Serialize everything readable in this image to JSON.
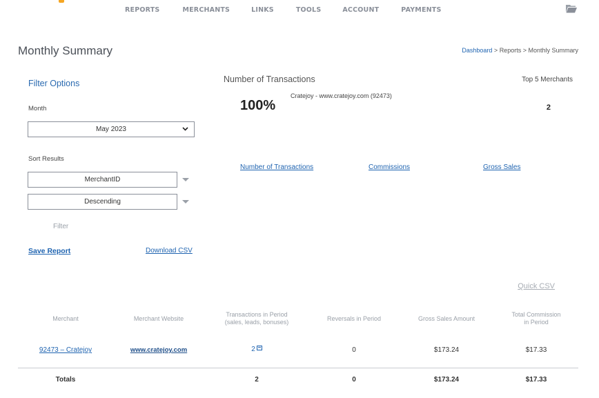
{
  "nav": {
    "items": [
      "REPORTS",
      "MERCHANTS",
      "LINKS",
      "TOOLS",
      "ACCOUNT",
      "PAYMENTS"
    ]
  },
  "icons": {
    "folder": "folder-open-icon",
    "logo": "logo-mark",
    "external": "external-link-icon",
    "dropdown": "chevron-down-icon"
  },
  "colors": {
    "link": "#1e63b0",
    "accent": "#f5a623",
    "muted": "#9aa0a8"
  },
  "page": {
    "title": "Monthly Summary"
  },
  "breadcrumb": {
    "dashboard": "Dashboard",
    "sep1": " > ",
    "reports": "Reports",
    "sep2": " > ",
    "current": "Monthly Summary"
  },
  "filter": {
    "title": "Filter Options",
    "month_label": "Month",
    "month_value": "May 2023",
    "sort_label": "Sort Results",
    "sort_by": "MerchantID",
    "sort_order": "Descending",
    "filter_button": "Filter",
    "save_report": "Save Report",
    "download_csv": "Download CSV"
  },
  "summary": {
    "title": "Number of Transactions",
    "top5_label": "Top 5 Merchants",
    "percent": "100%",
    "merchant_label": "Cratejoy - www.cratejoy.com (92473)",
    "top5_value": "2",
    "tabs": [
      "Number of Transactions",
      "Commissions",
      "Gross Sales"
    ]
  },
  "quick_csv": "Quick CSV",
  "table": {
    "headers": [
      "Merchant",
      "Merchant Website",
      "Transactions in Period\n(sales, leads, bonuses)",
      "Reversals in Period",
      "Gross Sales Amount",
      "Total Commission\nin Period"
    ],
    "rows": [
      {
        "merchant": "92473 – Cratejoy",
        "website": "www.cratejoy.com",
        "transactions": "2",
        "reversals": "0",
        "gross": "$173.24",
        "commission": "$17.33"
      }
    ],
    "totals": {
      "label": "Totals",
      "transactions": "2",
      "reversals": "0",
      "gross": "$173.24",
      "commission": "$17.33"
    }
  }
}
